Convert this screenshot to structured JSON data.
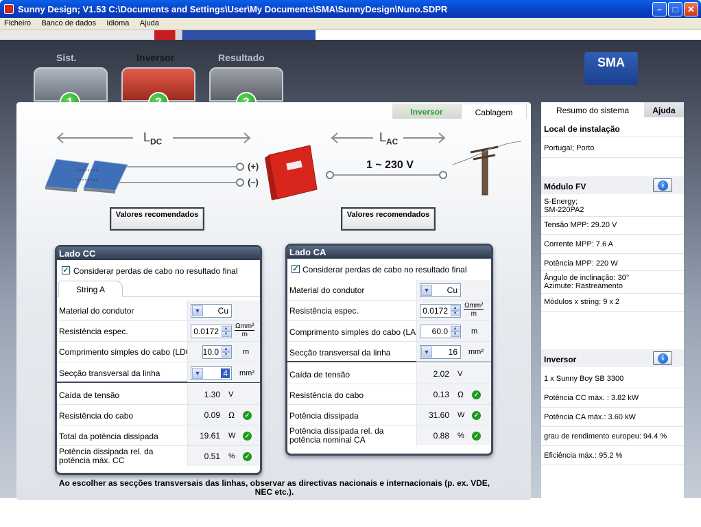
{
  "window": {
    "title": "Sunny Design; V1.53 C:\\Documents and Settings\\User\\My Documents\\SMA\\SunnyDesign\\Nuno.SDPR"
  },
  "menu": [
    "Ficheiro",
    "Banco de dados",
    "Idioma",
    "Ajuda"
  ],
  "steps": [
    {
      "label": "Sist.",
      "number": "1",
      "active": false
    },
    {
      "label": "Inversor",
      "number": "2",
      "active": true
    },
    {
      "label": "Resultado",
      "number": "3",
      "active": false
    }
  ],
  "logo": {
    "text": "SMA"
  },
  "main_tabs": {
    "inversor": "Inversor",
    "cablagem": "Cablagem"
  },
  "diagram": {
    "ldc": "L",
    "ldc_sub": "DC",
    "lac": "L",
    "lac_sub": "AC",
    "plus": "(+)",
    "minus": "(–)",
    "voltage": "1 ~ 230 V"
  },
  "buttons": {
    "dc_recommended": "Valores recomendados",
    "ac_recommended": "Valores recomendados"
  },
  "dc_panel": {
    "title": "Lado CC",
    "consider_losses": "Considerar perdas de cabo no resultado final",
    "string_tab": "String A",
    "conductor_label": "Material do condutor",
    "conductor_value": "Cu",
    "resistivity_label": "Resistência espec.",
    "resistivity_value": "0.0172",
    "resistivity_unit_num": "Ωmm²",
    "resistivity_unit_den": "m",
    "length_label": "Comprimento simples do cabo (LDC)",
    "length_value": "10.0",
    "length_unit": "m",
    "section_label": "Secção transversal da linha",
    "section_value": "4",
    "section_unit": "mm²",
    "voltage_drop_label": "Caída de tensão",
    "voltage_drop_value": "1.30",
    "voltage_drop_unit": "V",
    "cable_res_label": "Resistência do cabo",
    "cable_res_value": "0.09",
    "cable_res_unit": "Ω",
    "total_loss_label": "Total da potência dissipada",
    "total_loss_value": "19.61",
    "total_loss_unit": "W",
    "rel_loss_label": "Potência dissipada rel. da potência máx. CC",
    "rel_loss_value": "0.51",
    "rel_loss_unit": "%"
  },
  "ac_panel": {
    "title": "Lado CA",
    "consider_losses": "Considerar perdas de cabo no resultado final",
    "conductor_label": "Material do condutor",
    "conductor_value": "Cu",
    "resistivity_label": "Resistência espec.",
    "resistivity_value": "0.0172",
    "resistivity_unit_num": "Ωmm²",
    "resistivity_unit_den": "m",
    "length_label": "Comprimento simples do cabo (LAC)",
    "length_value": "60.0",
    "length_unit": "m",
    "section_label": "Secção transversal da linha",
    "section_value": "16",
    "section_unit": "mm²",
    "voltage_drop_label": "Caída de tensão",
    "voltage_drop_value": "2.02",
    "voltage_drop_unit": "V",
    "cable_res_label": "Resistência do cabo",
    "cable_res_value": "0.13",
    "cable_res_unit": "Ω",
    "power_loss_label": "Potência dissipada",
    "power_loss_value": "31.60",
    "power_loss_unit": "W",
    "rel_loss_label": "Potência dissipada rel. da potência nominal CA",
    "rel_loss_value": "0.88",
    "rel_loss_unit": "%"
  },
  "footnote": "Ao escolher as secções transversais das linhas, observar as directivas nacionais e internacionais (p. ex. VDE, NEC etc.).",
  "sidebar": {
    "tab_summary": "Resumo do sistema",
    "tab_help": "Ajuda",
    "location_title": "Local de instalação",
    "location_value": "Portugal; Porto",
    "module_title": "Módulo FV",
    "module_name_1": "S-Energy;",
    "module_name_2": "SM-220PA2",
    "mpp_voltage": "Tensão MPP: 29.20 V",
    "mpp_current": "Corrente MPP: 7.6 A",
    "mpp_power": "Potência MPP: 220 W",
    "tilt": "Ângulo de inclinação: 30°",
    "azimuth": "Azimute: Rastreamento",
    "modules_string": "Módulos x string: 9 x 2",
    "inverter_title": "Inversor",
    "inverter_name": "1 x Sunny Boy SB 3300",
    "dc_max": "Potência CC máx. : 3.82 kW",
    "ac_max": "Potência CA máx.: 3.60 kW",
    "euro_eff": "grau de rendimento europeu: 94.4 %",
    "max_eff": "Eficiência máx.: 95.2 %"
  }
}
